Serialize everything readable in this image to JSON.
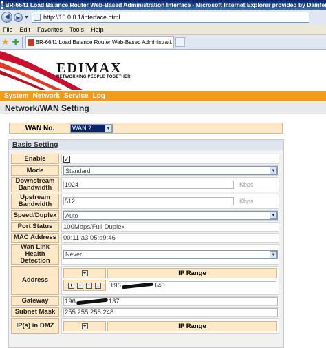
{
  "window": {
    "title": "BR-6641 Load Balance Router Web-Based Administration Interface - Microsoft Internet Explorer provided by Dainfern College"
  },
  "address_bar": {
    "url": "http://10.0.0.1/interface.html"
  },
  "menu": [
    "File",
    "Edit",
    "Favorites",
    "Tools",
    "Help"
  ],
  "tab": {
    "title": "BR-6641 Load Balance Router Web-Based Administrati..."
  },
  "brand": {
    "name": "EDIMAX",
    "tagline": "NETWORKING PEOPLE TOGETHER"
  },
  "nav": [
    "System",
    "Network",
    "Service",
    "Log"
  ],
  "page_title": "Network/WAN Setting",
  "wan": {
    "label": "WAN No.",
    "value": "WAN 2"
  },
  "basic": {
    "title": "Basic Setting",
    "enable": {
      "label": "Enable",
      "checked": true,
      "mark": "✓"
    },
    "mode": {
      "label": "Mode",
      "value": "Standard"
    },
    "down": {
      "label": "Downstream Bandwidth",
      "value": "1024",
      "unit": "Kbps"
    },
    "up": {
      "label": "Upstream Bandwidth",
      "value": "512",
      "unit": "Kbps"
    },
    "speed": {
      "label": "Speed/Duplex",
      "value": "Auto"
    },
    "port": {
      "label": "Port Status",
      "value": "100Mbps/Full Duplex"
    },
    "mac": {
      "label": "MAC Address",
      "value": "00:11:a3:05:d9:46"
    },
    "health": {
      "label": "Wan Link Health Detection",
      "value": "Never"
    },
    "address": {
      "label": "Address",
      "range_header": "IP Range",
      "prefix": "196",
      "suffix": "140"
    },
    "gateway": {
      "label": "Gateway",
      "prefix": "196",
      "suffix": "137"
    },
    "subnet": {
      "label": "Subnet Mask",
      "value": "255.255.255.248"
    },
    "dmz": {
      "label": "IP(s) in DMZ",
      "range_header": "IP Range"
    }
  }
}
